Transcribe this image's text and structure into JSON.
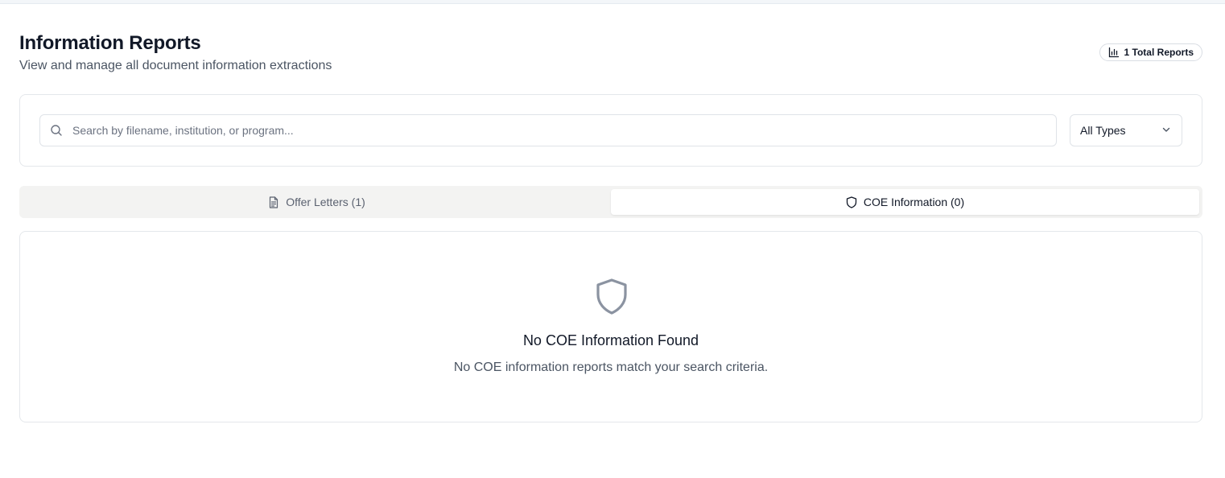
{
  "header": {
    "title": "Information Reports",
    "subtitle": "View and manage all document information extractions",
    "total_badge": {
      "icon": "bar-chart-icon",
      "label": "1 Total Reports"
    }
  },
  "filters": {
    "search": {
      "icon": "search-icon",
      "value": "",
      "placeholder": "Search by filename, institution, or program..."
    },
    "type_select": {
      "selected": "All Types",
      "icon": "chevron-down-icon"
    }
  },
  "tabs": [
    {
      "label": "Offer Letters (1)",
      "icon": "file-text-icon",
      "active": false
    },
    {
      "label": "COE Information (0)",
      "icon": "shield-icon",
      "active": true
    }
  ],
  "empty_state": {
    "icon": "shield-icon",
    "title": "No COE Information Found",
    "message": "No COE information reports match your search criteria."
  },
  "colors": {
    "text_primary": "#111827",
    "text_secondary": "#4b5563",
    "border": "#e4e7eb",
    "tab_bar_bg": "#f3f3f2",
    "empty_icon": "#8b93a1"
  }
}
